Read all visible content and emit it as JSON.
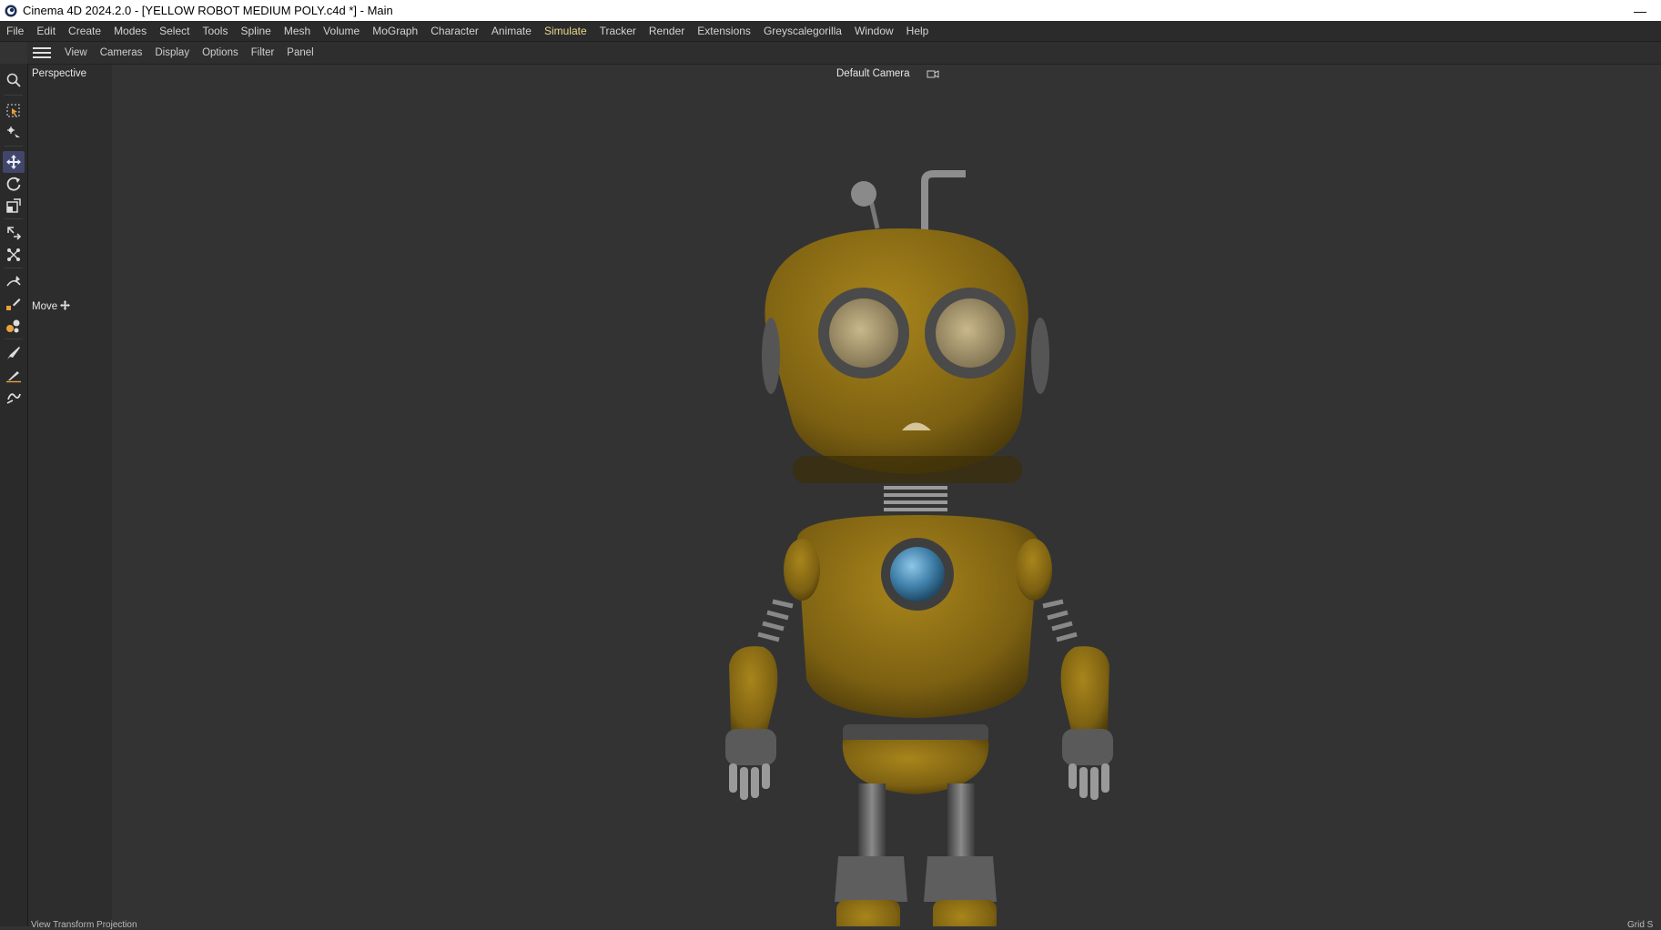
{
  "window": {
    "title": "Cinema 4D 2024.2.0 - [YELLOW ROBOT MEDIUM POLY.c4d *] - Main",
    "minimize_glyph": "—"
  },
  "menu": {
    "items": [
      "File",
      "Edit",
      "Create",
      "Modes",
      "Select",
      "Tools",
      "Spline",
      "Mesh",
      "Volume",
      "MoGraph",
      "Character",
      "Animate",
      "Simulate",
      "Tracker",
      "Render",
      "Extensions",
      "Greyscalegorilla",
      "Window",
      "Help"
    ],
    "active": "Simulate"
  },
  "viewport_menu": {
    "items": [
      "View",
      "Cameras",
      "Display",
      "Options",
      "Filter",
      "Panel"
    ]
  },
  "viewport": {
    "view_name": "Perspective",
    "camera_name": "Default Camera",
    "active_tool": "Move"
  },
  "toolbar": {
    "icons": [
      "search-icon",
      "live-selection-icon",
      "selection-options-icon",
      "move-icon",
      "rotate-icon",
      "scale-icon",
      "transfer-icon",
      "snap-icon",
      "spline-pen-icon",
      "spline-sketch-icon",
      "weight-paint-icon",
      "brush-icon",
      "knife-icon",
      "sculpt-icon"
    ],
    "active_tool": "move-icon"
  },
  "status": {
    "left": "View Transform  Projection",
    "right": "Grid S"
  },
  "colors": {
    "accent": "#41466a",
    "active_menu": "#e9d98f",
    "robot_body": "#9a7a16",
    "robot_eye_core": "#4a8ab5"
  }
}
